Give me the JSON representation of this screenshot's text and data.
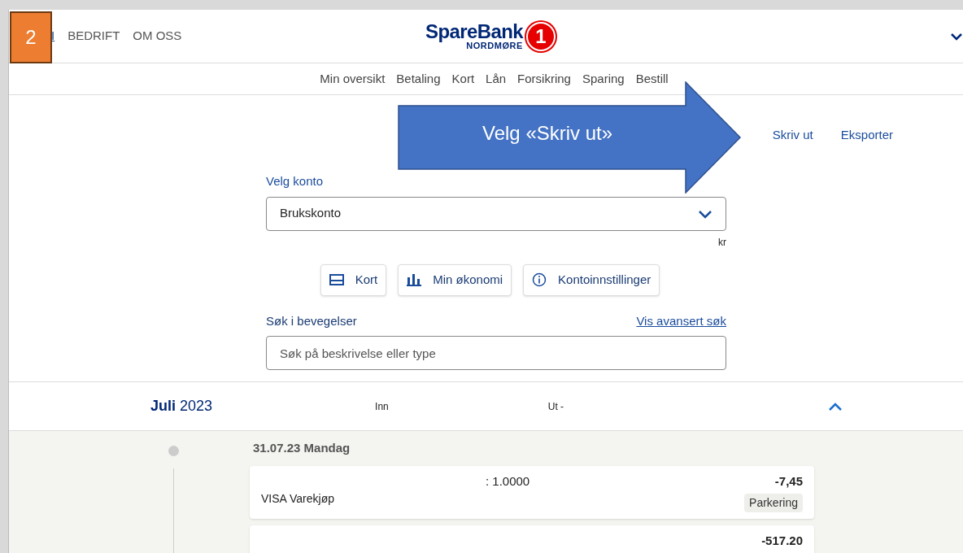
{
  "badge": "2",
  "top_nav": [
    {
      "label": "I",
      "selected": true
    },
    {
      "label": "BEDRIFT",
      "selected": false
    },
    {
      "label": "OM OSS",
      "selected": false
    }
  ],
  "logo": {
    "name": "SpareBank",
    "region": "NORDMØRE",
    "number": "1"
  },
  "main_nav": [
    "Min oversikt",
    "Betaling",
    "Kort",
    "Lån",
    "Forsikring",
    "Sparing",
    "Bestill"
  ],
  "callout": "Velg «Skriv ut»",
  "actions": [
    "Skriv ut",
    "Eksporter"
  ],
  "account": {
    "label": "Velg konto",
    "value": "Brukskonto",
    "balance": "kr"
  },
  "shortcuts": [
    {
      "kind": "card",
      "label": "Kort"
    },
    {
      "kind": "chart",
      "label": "Min økonomi"
    },
    {
      "kind": "info",
      "label": "Kontoinnstillinger"
    }
  ],
  "search": {
    "label": "Søk i bevegelser",
    "link": "Vis avansert søk",
    "placeholder": "Søk på beskrivelse eller type"
  },
  "month": {
    "name": "Juli",
    "year": "2023",
    "in": "Inn",
    "out": "Ut -",
    "expanded": true
  },
  "day": "31.07.23 Mandag",
  "transactions": [
    {
      "detail": ": 1.0000",
      "title": "VISA Varekjøp",
      "amount": "-7,45",
      "tag": "Parkering"
    },
    {
      "amount": "-517.20"
    }
  ]
}
